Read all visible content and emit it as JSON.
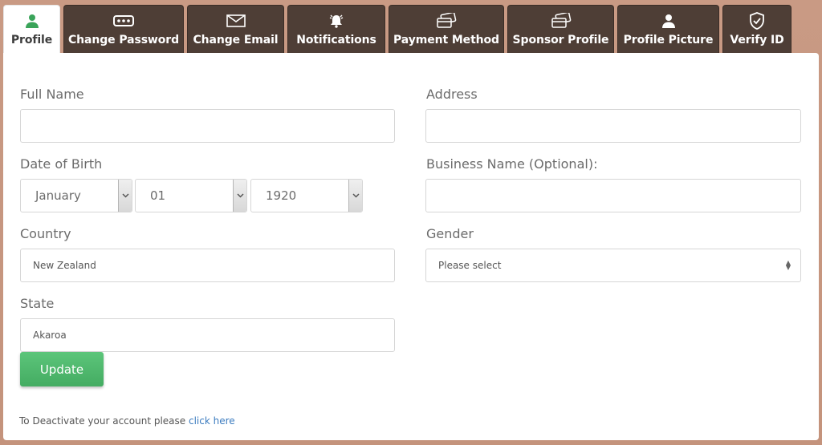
{
  "tabs": [
    {
      "label": "Profile",
      "icon": "user-icon",
      "active": true
    },
    {
      "label": "Change Password",
      "icon": "password-icon"
    },
    {
      "label": "Change Email",
      "icon": "envelope-icon"
    },
    {
      "label": "Notifications",
      "icon": "bell-icon"
    },
    {
      "label": "Payment Method",
      "icon": "cards-icon"
    },
    {
      "label": "Sponsor Profile",
      "icon": "cards-icon"
    },
    {
      "label": "Profile Picture",
      "icon": "user-icon"
    },
    {
      "label": "Verify ID",
      "icon": "shield-icon"
    }
  ],
  "form": {
    "full_name": {
      "label": "Full Name",
      "value": ""
    },
    "address": {
      "label": "Address",
      "value": ""
    },
    "dob": {
      "label": "Date of Birth",
      "month": "January",
      "day": "01",
      "year": "1920"
    },
    "business_name": {
      "label": "Business Name (Optional):",
      "value": ""
    },
    "country": {
      "label": "Country",
      "value": "New Zealand"
    },
    "gender": {
      "label": "Gender",
      "value": "Please select"
    },
    "state": {
      "label": "State",
      "value": "Akaroa"
    }
  },
  "update_label": "Update",
  "deactivate": {
    "text": "To Deactivate your account please ",
    "link": "click here"
  },
  "colors": {
    "tab_bg": "#4e3e36",
    "button": "#4cb56a",
    "link": "#3b7bbf",
    "background": "#c99a84"
  }
}
